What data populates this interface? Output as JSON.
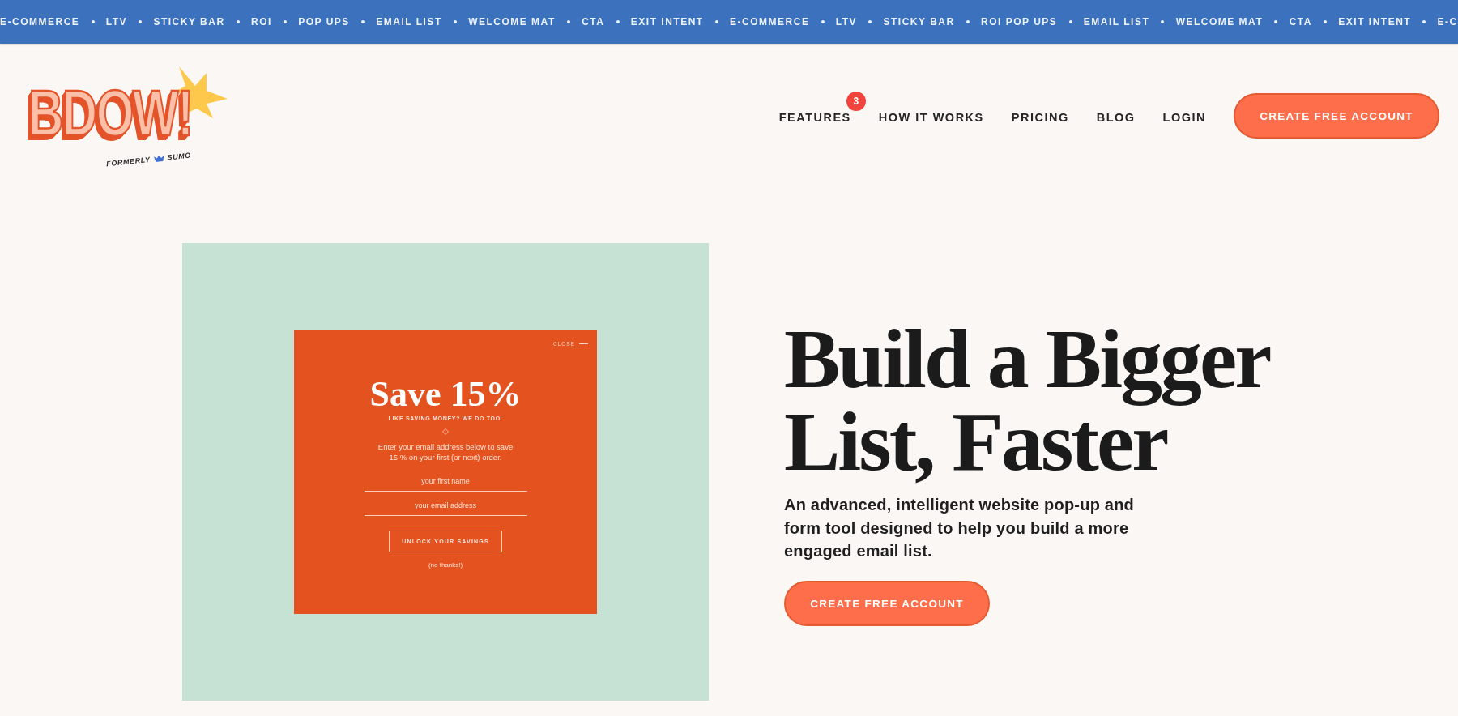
{
  "ticker": {
    "items": [
      "E-COMMERCE",
      "LTV",
      "STICKY BAR",
      "ROI",
      "POP UPS",
      "EMAIL LIST",
      "WELCOME MAT",
      "CTA",
      "EXIT INTENT",
      "E-COMMERCE",
      "LTV",
      "STICKY BAR",
      "ROI POP UPS",
      "EMAIL LIST",
      "WELCOME MAT",
      "CTA",
      "EXIT INTENT",
      "E-C"
    ]
  },
  "header": {
    "logo": {
      "wordmark": "BDOW!",
      "formerly": "FORMERLY",
      "former_name": "SUMO"
    },
    "nav": [
      {
        "label": "FEATURES",
        "badge": "3"
      },
      {
        "label": "HOW IT WORKS"
      },
      {
        "label": "PRICING"
      },
      {
        "label": "BLOG"
      },
      {
        "label": "LOGIN"
      }
    ],
    "cta": "CREATE FREE ACCOUNT"
  },
  "hero": {
    "preview": {
      "close": "CLOSE",
      "title": "Save 15%",
      "subtitle": "LIKE SAVING MONEY? WE DO TOO.",
      "description": "Enter your email address below to save 15 % on your first (or next) order.",
      "fields": [
        {
          "placeholder": "your first name"
        },
        {
          "placeholder": "your email address"
        }
      ],
      "button": "UNLOCK YOUR SAVINGS",
      "decline": "(no thanks!)"
    },
    "heading": "Build a Bigger List, Faster",
    "text": "An advanced, intelligent website pop-up and form tool designed to help you build a more engaged email list.",
    "cta": "CREATE FREE ACCOUNT"
  }
}
